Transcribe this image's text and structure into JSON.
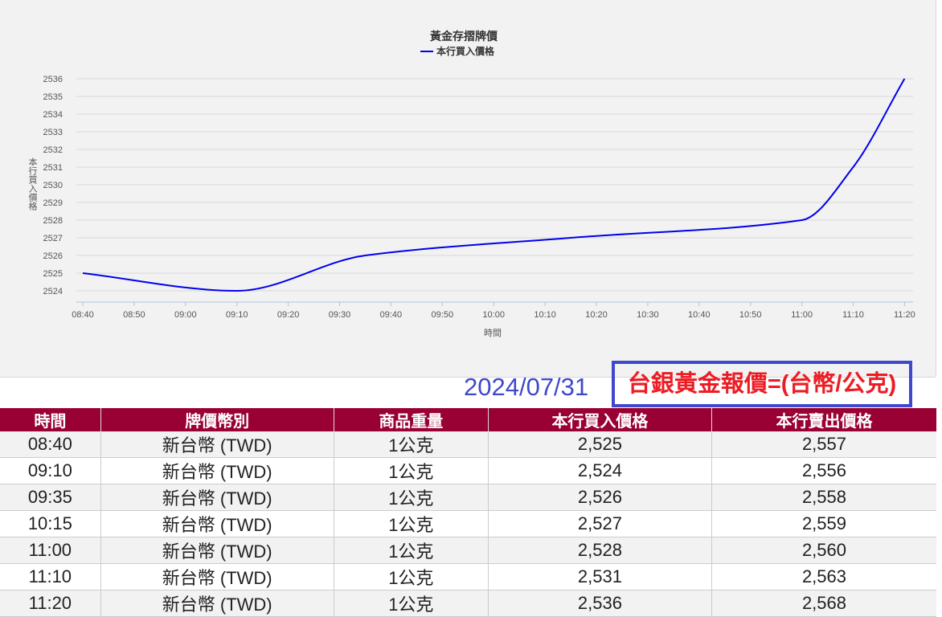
{
  "chart_data": {
    "type": "line",
    "title": "黃金存摺牌價",
    "legend": [
      "本行買入價格"
    ],
    "legend_position": "top-center",
    "xlabel": "時間",
    "ylabel": "本行買入價格",
    "x_ticks": [
      "08:40",
      "08:50",
      "09:00",
      "09:10",
      "09:20",
      "09:30",
      "09:40",
      "09:50",
      "10:00",
      "10:10",
      "10:20",
      "10:30",
      "10:40",
      "10:50",
      "11:00",
      "11:10",
      "11:20"
    ],
    "y_ticks": [
      2524,
      2525,
      2526,
      2527,
      2528,
      2529,
      2530,
      2531,
      2532,
      2533,
      2534,
      2535,
      2536
    ],
    "ylim": [
      2523.4,
      2536
    ],
    "grid": true,
    "color": "#0000ee",
    "series": [
      {
        "name": "本行買入價格",
        "x": [
          "08:40",
          "09:10",
          "09:35",
          "10:15",
          "11:00",
          "11:10",
          "11:20"
        ],
        "values": [
          2525,
          2524,
          2526,
          2527,
          2528,
          2531,
          2536
        ]
      }
    ]
  },
  "date": "2024/07/31",
  "price_title": "台銀黃金報價=(台幣/公克)",
  "table": {
    "headers": [
      "時間",
      "牌價幣別",
      "商品重量",
      "本行買入價格",
      "本行賣出價格"
    ],
    "rows": [
      [
        "08:40",
        "新台幣 (TWD)",
        "1公克",
        "2,525",
        "2,557"
      ],
      [
        "09:10",
        "新台幣 (TWD)",
        "1公克",
        "2,524",
        "2,556"
      ],
      [
        "09:35",
        "新台幣 (TWD)",
        "1公克",
        "2,526",
        "2,558"
      ],
      [
        "10:15",
        "新台幣 (TWD)",
        "1公克",
        "2,527",
        "2,559"
      ],
      [
        "11:00",
        "新台幣 (TWD)",
        "1公克",
        "2,528",
        "2,560"
      ],
      [
        "11:10",
        "新台幣 (TWD)",
        "1公克",
        "2,531",
        "2,563"
      ],
      [
        "11:20",
        "新台幣 (TWD)",
        "1公克",
        "2,536",
        "2,568"
      ]
    ]
  }
}
